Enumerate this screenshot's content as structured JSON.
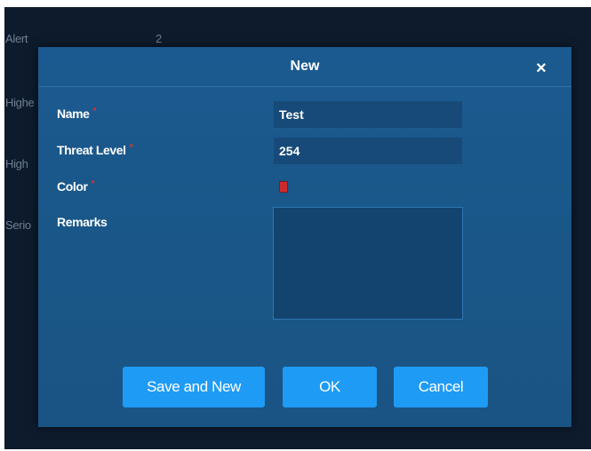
{
  "background": {
    "rows": [
      {
        "label": "Alert",
        "value": "2"
      },
      {
        "label": "Highe"
      },
      {
        "label": "High"
      },
      {
        "label": "Serio"
      }
    ]
  },
  "dialog": {
    "title": "New",
    "close_glyph": "×",
    "fields": {
      "name": {
        "label": "Name",
        "required_mark": "*",
        "value": "Test"
      },
      "threat_level": {
        "label": "Threat Level",
        "required_mark": "*",
        "value": "254"
      },
      "color": {
        "label": "Color",
        "required_mark": "*",
        "value_color": "#cf2b2b"
      },
      "remarks": {
        "label": "Remarks",
        "value": ""
      }
    },
    "buttons": {
      "save_and_new": "Save and New",
      "ok": "OK",
      "cancel": "Cancel"
    }
  },
  "colors": {
    "dialog_bg": "#1b5a90",
    "input_bg": "#174a78",
    "button_bg": "#1e9bf5",
    "required": "#e0322c",
    "background_window": "#0d1b2c"
  },
  "icons": {
    "close": "close-icon"
  }
}
